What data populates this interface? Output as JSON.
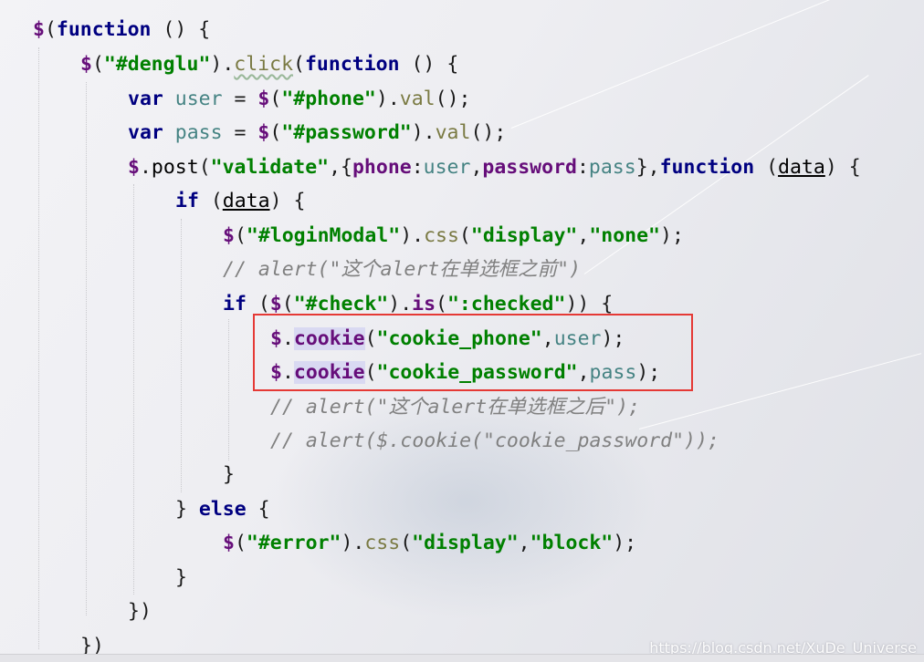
{
  "code_lines": [
    {
      "tokens": [
        {
          "t": "$",
          "c": "dollar"
        },
        {
          "t": "(",
          "c": "punc"
        },
        {
          "t": "function",
          "c": "kw"
        },
        {
          "t": " () {",
          "c": "punc"
        }
      ]
    },
    {
      "tokens": [
        {
          "t": "$",
          "c": "dollar"
        },
        {
          "t": "(",
          "c": "punc"
        },
        {
          "t": "\"#denglu\"",
          "c": "str"
        },
        {
          "t": ").",
          "c": "punc"
        },
        {
          "t": "click",
          "c": "meth squig"
        },
        {
          "t": "(",
          "c": "punc"
        },
        {
          "t": "function",
          "c": "kw"
        },
        {
          "t": " () {",
          "c": "punc"
        }
      ]
    },
    {
      "tokens": [
        {
          "t": "var",
          "c": "kw"
        },
        {
          "t": " ",
          "c": "punc"
        },
        {
          "t": "user",
          "c": "var"
        },
        {
          "t": " = ",
          "c": "punc"
        },
        {
          "t": "$",
          "c": "dollar"
        },
        {
          "t": "(",
          "c": "punc"
        },
        {
          "t": "\"#phone\"",
          "c": "str"
        },
        {
          "t": ").",
          "c": "punc"
        },
        {
          "t": "val",
          "c": "meth"
        },
        {
          "t": "();",
          "c": "punc"
        }
      ]
    },
    {
      "tokens": [
        {
          "t": "var",
          "c": "kw"
        },
        {
          "t": " ",
          "c": "punc"
        },
        {
          "t": "pass",
          "c": "var"
        },
        {
          "t": " = ",
          "c": "punc"
        },
        {
          "t": "$",
          "c": "dollar"
        },
        {
          "t": "(",
          "c": "punc"
        },
        {
          "t": "\"#password\"",
          "c": "str"
        },
        {
          "t": ").",
          "c": "punc"
        },
        {
          "t": "val",
          "c": "meth"
        },
        {
          "t": "();",
          "c": "punc"
        }
      ]
    },
    {
      "tokens": [
        {
          "t": "$",
          "c": "dollar"
        },
        {
          "t": ".",
          "c": "punc"
        },
        {
          "t": "post",
          "c": "fn"
        },
        {
          "t": "(",
          "c": "punc"
        },
        {
          "t": "\"validate\"",
          "c": "str"
        },
        {
          "t": ",{",
          "c": "punc"
        },
        {
          "t": "phone",
          "c": "prop"
        },
        {
          "t": ":",
          "c": "punc"
        },
        {
          "t": "user",
          "c": "var"
        },
        {
          "t": ",",
          "c": "punc"
        },
        {
          "t": "password",
          "c": "prop"
        },
        {
          "t": ":",
          "c": "punc"
        },
        {
          "t": "pass",
          "c": "var"
        },
        {
          "t": "},",
          "c": "punc"
        },
        {
          "t": "function",
          "c": "kw"
        },
        {
          "t": " (",
          "c": "punc"
        },
        {
          "t": "data",
          "c": "param"
        },
        {
          "t": ") {",
          "c": "punc"
        }
      ]
    },
    {
      "tokens": [
        {
          "t": "if",
          "c": "kw"
        },
        {
          "t": " (",
          "c": "punc"
        },
        {
          "t": "data",
          "c": "param"
        },
        {
          "t": ") {",
          "c": "punc"
        }
      ]
    },
    {
      "tokens": [
        {
          "t": "$",
          "c": "dollar"
        },
        {
          "t": "(",
          "c": "punc"
        },
        {
          "t": "\"#loginModal\"",
          "c": "str"
        },
        {
          "t": ").",
          "c": "punc"
        },
        {
          "t": "css",
          "c": "meth"
        },
        {
          "t": "(",
          "c": "punc"
        },
        {
          "t": "\"display\"",
          "c": "str"
        },
        {
          "t": ",",
          "c": "punc"
        },
        {
          "t": "\"none\"",
          "c": "str"
        },
        {
          "t": ");",
          "c": "punc"
        }
      ]
    },
    {
      "tokens": [
        {
          "t": "// alert(\"这个alert在单选框之前\")",
          "c": "cmt"
        }
      ]
    },
    {
      "tokens": [
        {
          "t": "if",
          "c": "kw"
        },
        {
          "t": " (",
          "c": "punc"
        },
        {
          "t": "$",
          "c": "dollar"
        },
        {
          "t": "(",
          "c": "punc"
        },
        {
          "t": "\"#check\"",
          "c": "str"
        },
        {
          "t": ").",
          "c": "punc"
        },
        {
          "t": "is",
          "c": "prop"
        },
        {
          "t": "(",
          "c": "punc"
        },
        {
          "t": "\":checked\"",
          "c": "str"
        },
        {
          "t": ")) {",
          "c": "punc"
        }
      ]
    },
    {
      "tokens": [
        {
          "t": "$",
          "c": "dollar"
        },
        {
          "t": ".",
          "c": "punc"
        },
        {
          "t": "cookie",
          "c": "prop hl"
        },
        {
          "t": "(",
          "c": "punc"
        },
        {
          "t": "\"cookie_phone\"",
          "c": "str"
        },
        {
          "t": ",",
          "c": "punc"
        },
        {
          "t": "user",
          "c": "var"
        },
        {
          "t": ");",
          "c": "punc"
        }
      ]
    },
    {
      "tokens": [
        {
          "t": "$",
          "c": "dollar"
        },
        {
          "t": ".",
          "c": "punc"
        },
        {
          "t": "cookie",
          "c": "prop hl"
        },
        {
          "t": "(",
          "c": "punc"
        },
        {
          "t": "\"cookie_password\"",
          "c": "str"
        },
        {
          "t": ",",
          "c": "punc"
        },
        {
          "t": "pass",
          "c": "var"
        },
        {
          "t": ");",
          "c": "punc"
        }
      ]
    },
    {
      "tokens": [
        {
          "t": "// alert(\"这个alert在单选框之后\");",
          "c": "cmt"
        }
      ]
    },
    {
      "tokens": [
        {
          "t": "// alert($.cookie(\"cookie_password\"));",
          "c": "cmt"
        }
      ]
    },
    {
      "tokens": [
        {
          "t": "}",
          "c": "punc"
        }
      ]
    },
    {
      "tokens": [
        {
          "t": "} ",
          "c": "punc"
        },
        {
          "t": "else",
          "c": "kw"
        },
        {
          "t": " {",
          "c": "punc"
        }
      ]
    },
    {
      "tokens": [
        {
          "t": "$",
          "c": "dollar"
        },
        {
          "t": "(",
          "c": "punc"
        },
        {
          "t": "\"#error\"",
          "c": "str"
        },
        {
          "t": ").",
          "c": "punc"
        },
        {
          "t": "css",
          "c": "meth"
        },
        {
          "t": "(",
          "c": "punc"
        },
        {
          "t": "\"display\"",
          "c": "str"
        },
        {
          "t": ",",
          "c": "punc"
        },
        {
          "t": "\"block\"",
          "c": "str"
        },
        {
          "t": ");",
          "c": "punc"
        }
      ]
    },
    {
      "tokens": [
        {
          "t": "}",
          "c": "punc"
        }
      ]
    },
    {
      "tokens": [
        {
          "t": "})",
          "c": "punc"
        }
      ]
    },
    {
      "tokens": [
        {
          "t": "})",
          "c": "punc"
        }
      ]
    }
  ],
  "watermark": "https://blog.csdn.net/XuDe_Universe",
  "highlight_box_color": "#e53935"
}
